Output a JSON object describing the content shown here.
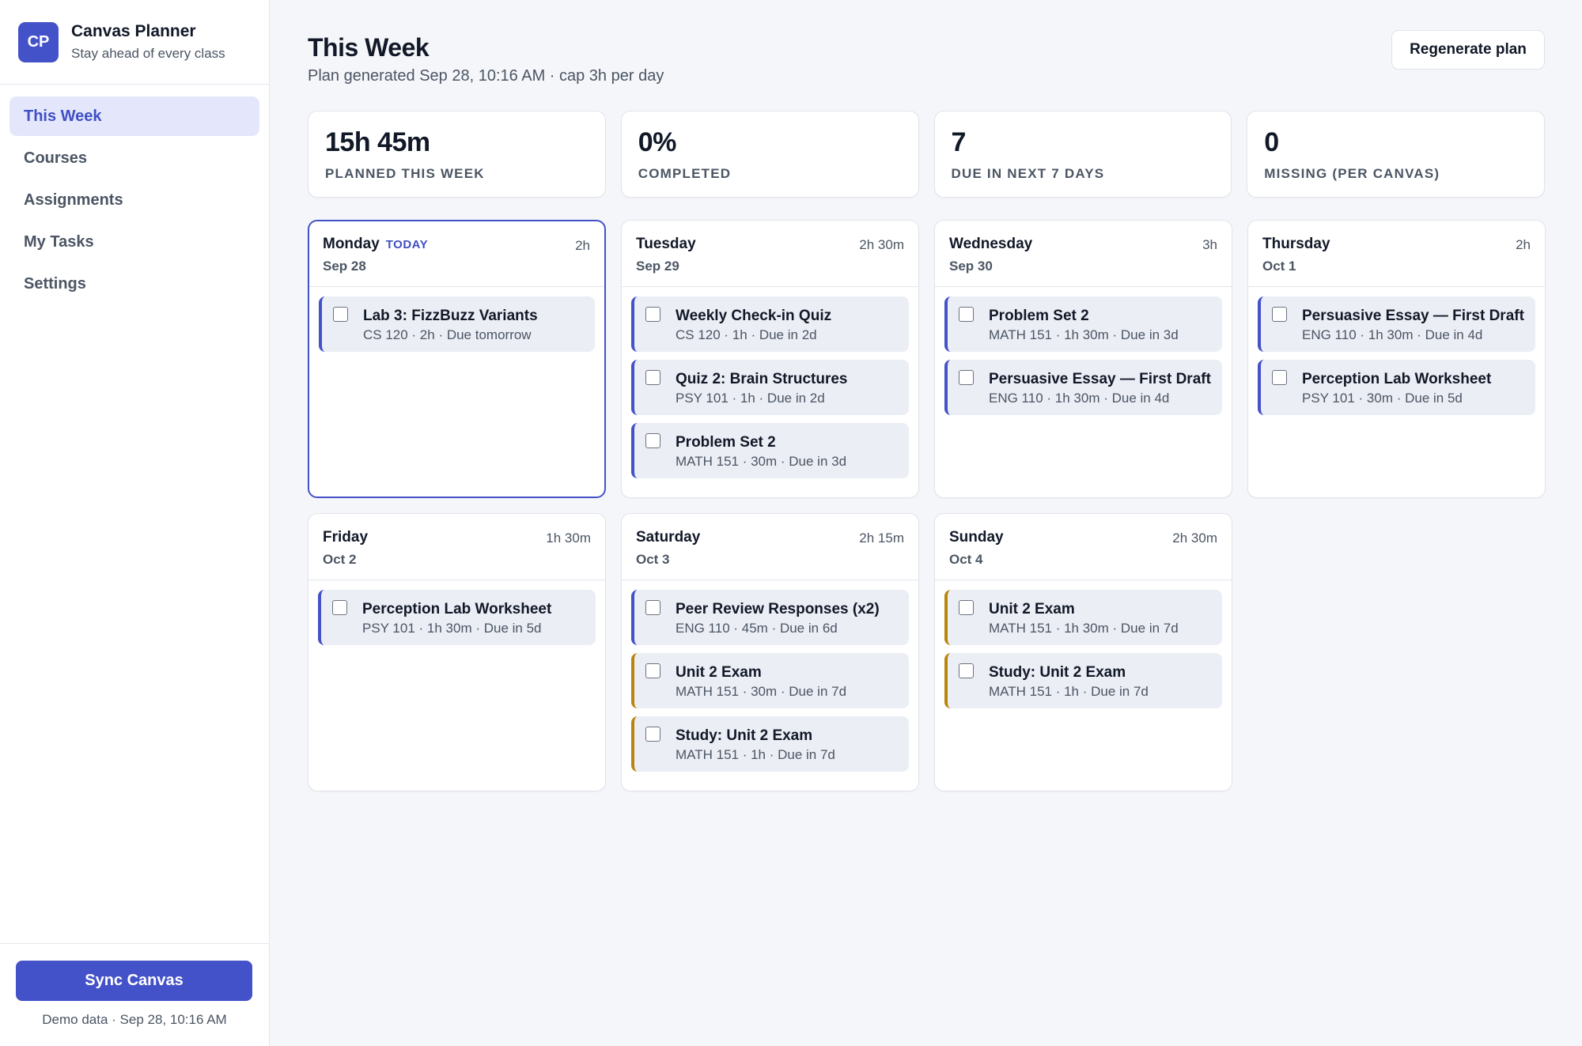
{
  "brand": {
    "logo": "CP",
    "title": "Canvas Planner",
    "subtitle": "Stay ahead of every class"
  },
  "nav": [
    {
      "label": "This Week",
      "active": true
    },
    {
      "label": "Courses",
      "active": false
    },
    {
      "label": "Assignments",
      "active": false
    },
    {
      "label": "My Tasks",
      "active": false
    },
    {
      "label": "Settings",
      "active": false
    }
  ],
  "footer": {
    "sync_label": "Sync Canvas",
    "note": "Demo data · Sep 28, 10:16 AM"
  },
  "header": {
    "title": "This Week",
    "subtitle": "Plan generated Sep 28, 10:16 AM · cap 3h per day",
    "regen_label": "Regenerate plan"
  },
  "stats": [
    {
      "value": "15h 45m",
      "label": "PLANNED THIS WEEK"
    },
    {
      "value": "0%",
      "label": "COMPLETED"
    },
    {
      "value": "7",
      "label": "DUE IN NEXT 7 DAYS"
    },
    {
      "value": "0",
      "label": "MISSING (PER CANVAS)"
    }
  ],
  "colors": {
    "accent": "#4452c9",
    "exam": "#b8860b"
  },
  "today_label": "TODAY",
  "days": [
    {
      "name": "Monday",
      "date": "Sep 28",
      "total": "2h",
      "today": true,
      "tasks": [
        {
          "title": "Lab 3: FizzBuzz Variants",
          "meta": "CS 120 · 2h · Due tomorrow",
          "exam": false
        }
      ]
    },
    {
      "name": "Tuesday",
      "date": "Sep 29",
      "total": "2h 30m",
      "today": false,
      "tasks": [
        {
          "title": "Weekly Check-in Quiz",
          "meta": "CS 120 · 1h · Due in 2d",
          "exam": false
        },
        {
          "title": "Quiz 2: Brain Structures",
          "meta": "PSY 101 · 1h · Due in 2d",
          "exam": false
        },
        {
          "title": "Problem Set 2",
          "meta": "MATH 151 · 30m · Due in 3d",
          "exam": false
        }
      ]
    },
    {
      "name": "Wednesday",
      "date": "Sep 30",
      "total": "3h",
      "today": false,
      "tasks": [
        {
          "title": "Problem Set 2",
          "meta": "MATH 151 · 1h 30m · Due in 3d",
          "exam": false
        },
        {
          "title": "Persuasive Essay — First Draft",
          "meta": "ENG 110 · 1h 30m · Due in 4d",
          "exam": false
        }
      ]
    },
    {
      "name": "Thursday",
      "date": "Oct 1",
      "total": "2h",
      "today": false,
      "tasks": [
        {
          "title": "Persuasive Essay — First Draft",
          "meta": "ENG 110 · 1h 30m · Due in 4d",
          "exam": false
        },
        {
          "title": "Perception Lab Worksheet",
          "meta": "PSY 101 · 30m · Due in 5d",
          "exam": false
        }
      ]
    },
    {
      "name": "Friday",
      "date": "Oct 2",
      "total": "1h 30m",
      "today": false,
      "tasks": [
        {
          "title": "Perception Lab Worksheet",
          "meta": "PSY 101 · 1h 30m · Due in 5d",
          "exam": false
        }
      ]
    },
    {
      "name": "Saturday",
      "date": "Oct 3",
      "total": "2h 15m",
      "today": false,
      "tasks": [
        {
          "title": "Peer Review Responses (x2)",
          "meta": "ENG 110 · 45m · Due in 6d",
          "exam": false
        },
        {
          "title": "Unit 2 Exam",
          "meta": "MATH 151 · 30m · Due in 7d",
          "exam": true
        },
        {
          "title": "Study: Unit 2 Exam",
          "meta": "MATH 151 · 1h · Due in 7d",
          "exam": true
        }
      ]
    },
    {
      "name": "Sunday",
      "date": "Oct 4",
      "total": "2h 30m",
      "today": false,
      "tasks": [
        {
          "title": "Unit 2 Exam",
          "meta": "MATH 151 · 1h 30m · Due in 7d",
          "exam": true
        },
        {
          "title": "Study: Unit 2 Exam",
          "meta": "MATH 151 · 1h · Due in 7d",
          "exam": true
        }
      ]
    }
  ]
}
